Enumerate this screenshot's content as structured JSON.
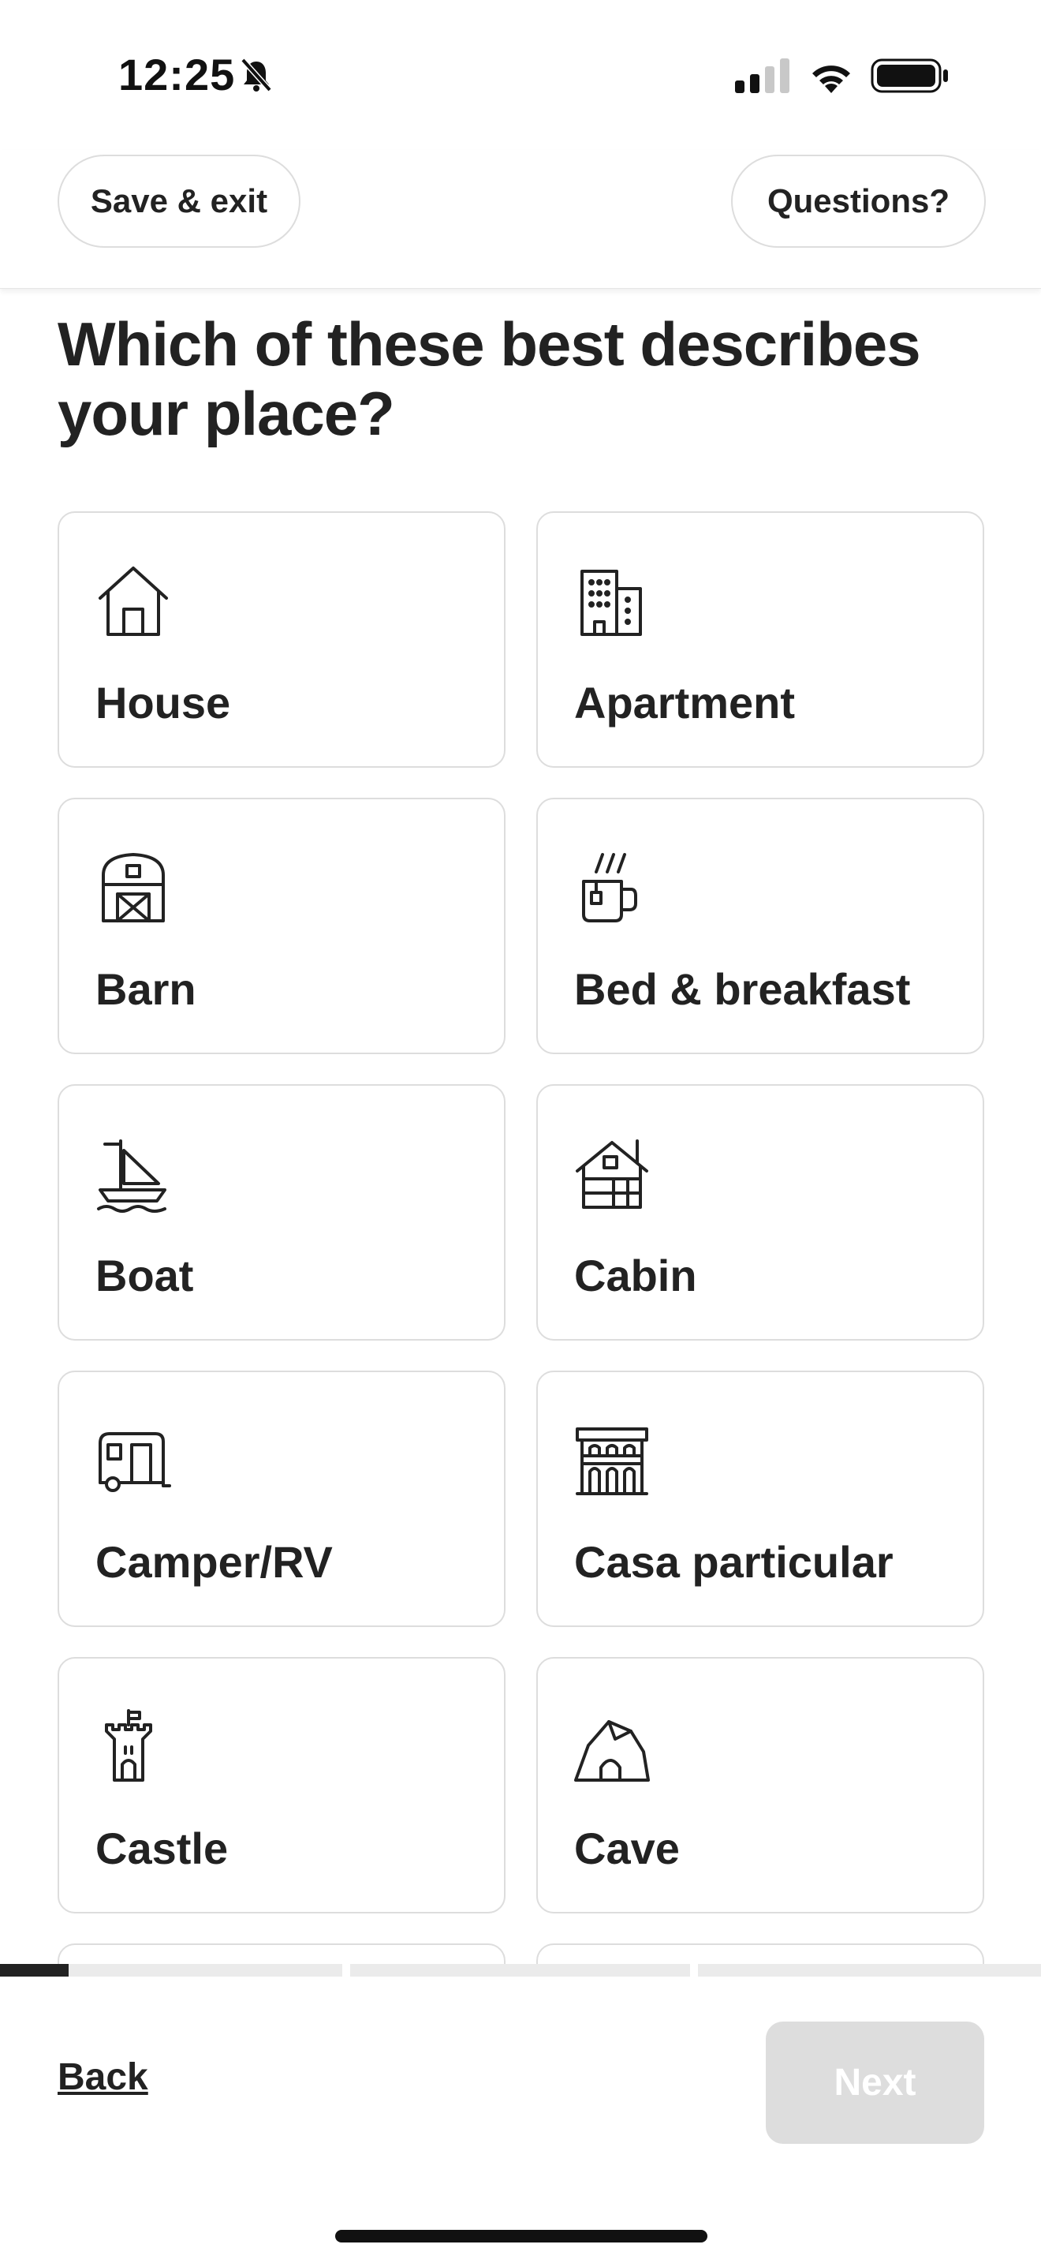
{
  "status_bar": {
    "time": "12:25",
    "icons": [
      "bell-muted-icon",
      "signal-icon",
      "wifi-icon",
      "battery-icon"
    ]
  },
  "header": {
    "save_exit_label": "Save & exit",
    "questions_label": "Questions?"
  },
  "title": "Which of these best describes your place?",
  "cards": [
    {
      "label": "House",
      "icon": "house-icon"
    },
    {
      "label": "Apartment",
      "icon": "apartment-icon"
    },
    {
      "label": "Barn",
      "icon": "barn-icon"
    },
    {
      "label": "Bed & breakfast",
      "icon": "mug-icon"
    },
    {
      "label": "Boat",
      "icon": "boat-icon"
    },
    {
      "label": "Cabin",
      "icon": "cabin-icon"
    },
    {
      "label": "Camper/RV",
      "icon": "camper-icon"
    },
    {
      "label": "Casa particular",
      "icon": "casa-particular-icon"
    },
    {
      "label": "Castle",
      "icon": "castle-icon"
    },
    {
      "label": "Cave",
      "icon": "cave-icon"
    }
  ],
  "progress": {
    "segments": 4,
    "current_segment_fill": 0.2
  },
  "footer": {
    "back_label": "Back",
    "next_label": "Next",
    "next_enabled": false
  },
  "colors": {
    "text": "#222222",
    "border": "#dddddd",
    "disabled_button": "#dddddd",
    "progress_track": "#ebebeb",
    "progress_fill": "#222222"
  }
}
